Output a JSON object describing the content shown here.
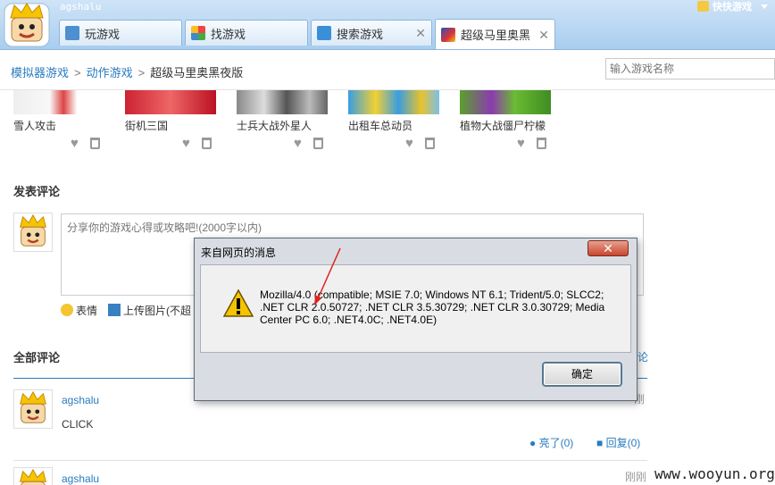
{
  "topbar": {
    "username": "agshalu",
    "right_label": "快快游戏",
    "tabs": [
      {
        "label": "玩游戏",
        "icon": "gamepad-icon"
      },
      {
        "label": "找游戏",
        "icon": "grid-icon"
      },
      {
        "label": "搜索游戏",
        "icon": "search-icon"
      },
      {
        "label": "超级马里奥黑",
        "icon": "game-thumb-icon"
      }
    ]
  },
  "breadcrumb": [
    "模拟器游戏",
    "动作游戏",
    "超级马里奥黑夜版"
  ],
  "search": {
    "placeholder": "输入游戏名称"
  },
  "games": [
    {
      "name": "雪人攻击"
    },
    {
      "name": "街机三国"
    },
    {
      "name": "士兵大战外星人"
    },
    {
      "name": "出租车总动员"
    },
    {
      "name": "植物大战僵尸柠檬"
    }
  ],
  "post_section": {
    "title": "发表评论",
    "placeholder": "分享你的游戏心得或攻略吧!(2000字以内)",
    "emoji_label": "表情",
    "upload_label": "上传图片(不超"
  },
  "all_section": {
    "title": "全部评论",
    "right_fragment": "论"
  },
  "comments": [
    {
      "user": "agshalu",
      "text": "CLICK",
      "time": "刚",
      "like": "亮了(0)",
      "reply": "回复(0)"
    },
    {
      "user": "agshalu",
      "time": "刚刚"
    }
  ],
  "dialog": {
    "title": "来自网页的消息",
    "close": "✕",
    "message_lines": [
      "Mozilla/4.0 (compatible; MSIE 7.0; Windows NT 6.1; Trident/5.0; SLCC2;",
      ".NET CLR 2.0.50727; .NET CLR 3.5.30729; .NET CLR 3.0.30729; Media",
      "Center PC 6.0; .NET4.0C; .NET4.0E)"
    ],
    "ok_label": "确定"
  },
  "watermark": "www.wooyun.org",
  "colors": {
    "link": "#2a7bbf",
    "topbar": "#a9cdef",
    "dialog_frame": "#d9dde3"
  }
}
